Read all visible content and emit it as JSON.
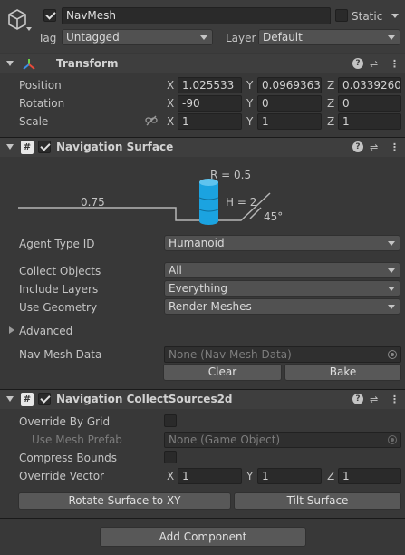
{
  "object": {
    "name": "NavMesh",
    "static_label": "Static",
    "tag_label": "Tag",
    "tag_value": "Untagged",
    "layer_label": "Layer",
    "layer_value": "Default"
  },
  "transform": {
    "title": "Transform",
    "position": {
      "label": "Position",
      "x": "1.025533",
      "y": "0.0969363",
      "z": "0.0339260"
    },
    "rotation": {
      "label": "Rotation",
      "x": "-90",
      "y": "0",
      "z": "0"
    },
    "scale": {
      "label": "Scale",
      "x": "1",
      "y": "1",
      "z": "1"
    }
  },
  "axes": {
    "x": "X",
    "y": "Y",
    "z": "Z"
  },
  "surface": {
    "title": "Navigation Surface",
    "diagram": {
      "radius": "R = 0.5",
      "height": "H = 2",
      "step": "0.75",
      "slope": "45°"
    },
    "agent_type": {
      "label": "Agent Type ID",
      "value": "Humanoid"
    },
    "collect": {
      "label": "Collect Objects",
      "value": "All"
    },
    "layers": {
      "label": "Include Layers",
      "value": "Everything"
    },
    "geometry": {
      "label": "Use Geometry",
      "value": "Render Meshes"
    },
    "advanced": "Advanced",
    "navmesh_data": {
      "label": "Nav Mesh Data",
      "value": "None (Nav Mesh Data)"
    },
    "clear": "Clear",
    "bake": "Bake"
  },
  "collect2d": {
    "title": "Navigation CollectSources2d",
    "override_grid": "Override By Grid",
    "mesh_prefab": {
      "label": "Use Mesh Prefab",
      "value": "None (Game Object)"
    },
    "compress": "Compress Bounds",
    "override_vector": {
      "label": "Override Vector",
      "x": "1",
      "y": "1",
      "z": "1"
    },
    "rotate_btn": "Rotate Surface to XY",
    "tilt_btn": "Tilt Surface"
  },
  "add_component": "Add Component",
  "colors": {
    "accent": "#1ba3e0",
    "checkbox": "#2a2a2a",
    "header": "#3e3e3e"
  }
}
